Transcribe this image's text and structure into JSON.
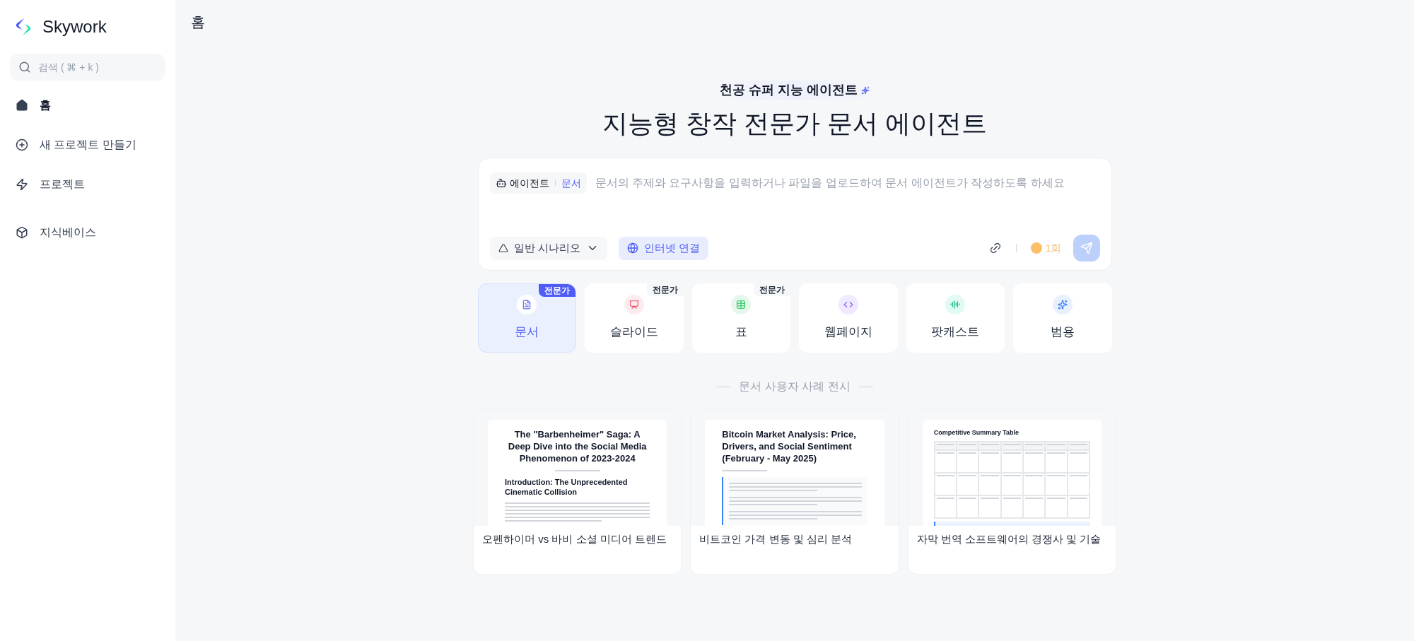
{
  "sidebar": {
    "logo": "Skywork",
    "search": {
      "placeholder": "검색 ( ⌘ + k )"
    },
    "items": [
      {
        "label": "홈",
        "selected": true
      },
      {
        "label": "새 프로젝트 만들기",
        "selected": false
      },
      {
        "label": "프로젝트",
        "selected": false
      },
      {
        "label": "지식베이스",
        "selected": false
      }
    ]
  },
  "header": {
    "title": "홈"
  },
  "hero": {
    "eyebrow": "천공 슈퍼 지능 에이전트",
    "title": "지능형 창작 전문가 문서 에이전트"
  },
  "composer": {
    "agent_label": "에이전트",
    "agent_type": "문서",
    "placeholder": "문서의 주제와 요구사항을 입력하거나 파일을 업로드하여 문서 에이전트가 작성하도록 하세요",
    "scenario": "일반 시나리오",
    "internet": {
      "label": "인터넷 연결",
      "on": true
    },
    "credits": "1회"
  },
  "modes": [
    {
      "label": "문서",
      "badge": "전문가",
      "selected": true
    },
    {
      "label": "슬라이드",
      "badge": "전문가",
      "selected": false
    },
    {
      "label": "표",
      "badge": "전문가",
      "selected": false
    },
    {
      "label": "웹페이지",
      "selected": false
    },
    {
      "label": "팟캐스트",
      "selected": false
    },
    {
      "label": "범용",
      "selected": false
    }
  ],
  "showcase": {
    "title": "문서 사용자 사례 전시",
    "cards": [
      {
        "kind": "article",
        "heading": "The \"Barbenheimer\" Saga: A Deep Dive into the Social Media Phenomenon of 2023-2024",
        "subheading": "Introduction: The Unprecedented Cinematic Collision",
        "caption": "오펜하이머 vs 바비 소셜 미디어 트렌드"
      },
      {
        "kind": "report",
        "heading": "Bitcoin Market Analysis: Price, Drivers, and Social Sentiment (February - May 2025)",
        "caption": "비트코인 가격 변동 및 심리 분석"
      },
      {
        "kind": "table",
        "heading": "Competitive Summary Table",
        "caption": "자막 번역 소프트웨어의 경쟁사 및 기술"
      }
    ]
  }
}
